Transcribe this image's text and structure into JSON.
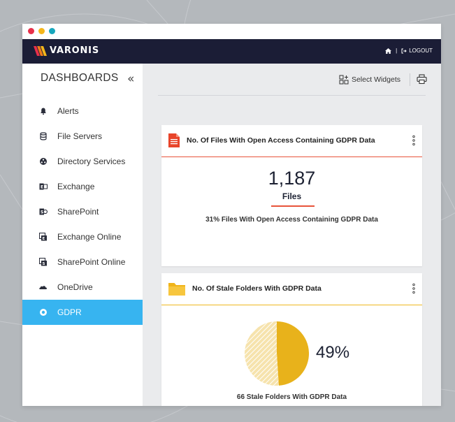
{
  "app": {
    "brand": "VARONIS",
    "brand_color": "#1b1d36",
    "accent": "#37b4f0"
  },
  "navbar": {
    "home_icon": "home-icon",
    "separator": "|",
    "logout_label": "LOGOUT"
  },
  "sidebar": {
    "title": "DASHBOARDS",
    "collapse_glyph": "«",
    "items": [
      {
        "label": "Alerts",
        "icon": "bell-icon"
      },
      {
        "label": "File Servers",
        "icon": "database-icon"
      },
      {
        "label": "Directory Services",
        "icon": "network-icon"
      },
      {
        "label": "Exchange",
        "icon": "exchange-icon"
      },
      {
        "label": "SharePoint",
        "icon": "sharepoint-icon"
      },
      {
        "label": "Exchange Online",
        "icon": "exchange-online-icon"
      },
      {
        "label": "SharePoint Online",
        "icon": "sharepoint-online-icon"
      },
      {
        "label": "OneDrive",
        "icon": "cloud-icon"
      },
      {
        "label": "GDPR",
        "icon": "gdpr-icon",
        "active": true
      }
    ]
  },
  "toolbar": {
    "select_widgets_label": "Select Widgets"
  },
  "widgets": [
    {
      "title": "No. Of Files With Open Access Containing GDPR Data",
      "icon": "document-icon",
      "accent": "#e8543a",
      "value": "1,187",
      "unit": "Files",
      "subtitle": "31% Files With Open Access Containing GDPR Data"
    },
    {
      "title": "No. Of Stale Folders With GDPR Data",
      "icon": "folder-icon",
      "accent": "#efb81f",
      "percent_label": "49%",
      "subtitle": "66 Stale Folders With GDPR Data"
    }
  ],
  "chart_data": {
    "type": "pie",
    "values": [
      49,
      51
    ],
    "colors": [
      "#e8b21b",
      "#f6e3ad"
    ]
  }
}
